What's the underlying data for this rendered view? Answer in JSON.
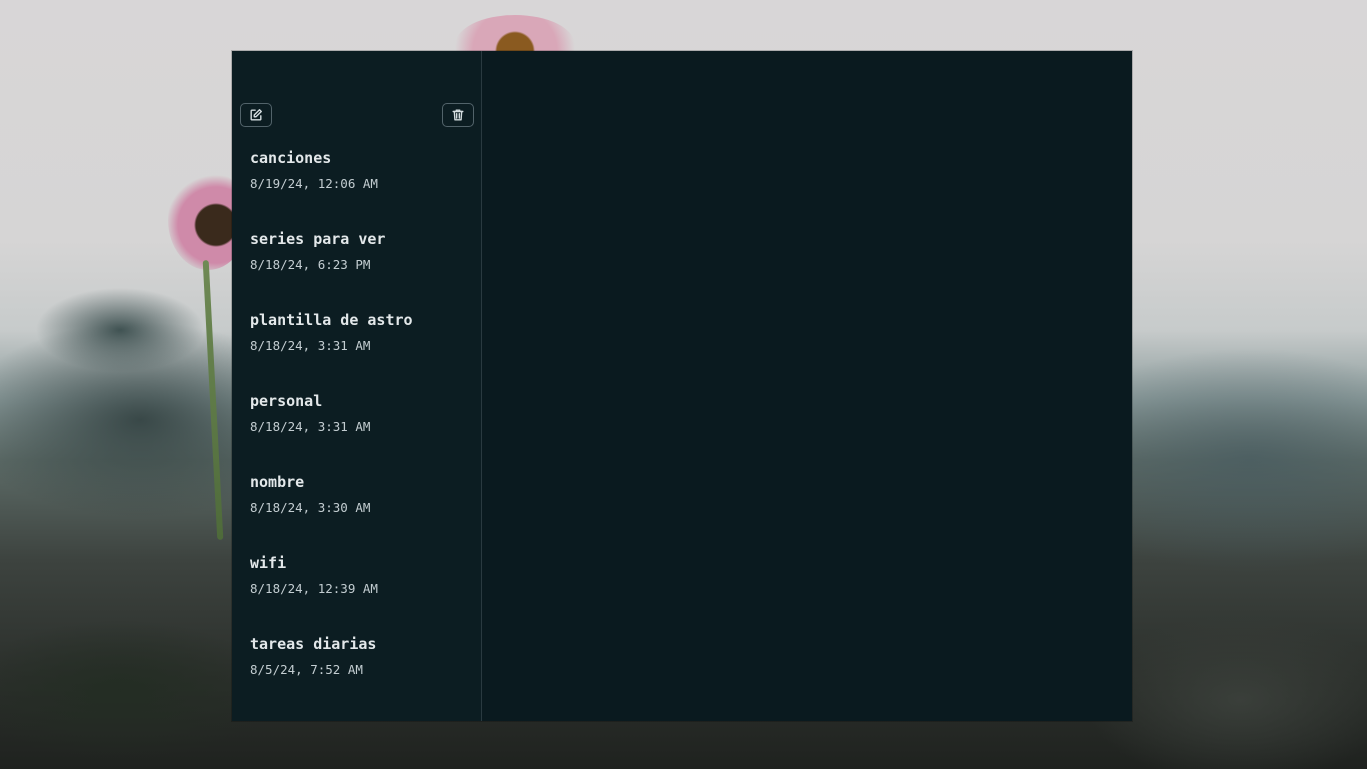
{
  "toolbar": {
    "new_note_icon": "edit-note-icon",
    "delete_icon": "trash-icon"
  },
  "notes": [
    {
      "title": "canciones",
      "date": "8/19/24, 12:06 AM"
    },
    {
      "title": "series para ver",
      "date": "8/18/24, 6:23 PM"
    },
    {
      "title": "plantilla de astro",
      "date": "8/18/24, 3:31 AM"
    },
    {
      "title": "personal",
      "date": "8/18/24, 3:31 AM"
    },
    {
      "title": "nombre",
      "date": "8/18/24, 3:30 AM"
    },
    {
      "title": "wifi",
      "date": "8/18/24, 12:39 AM"
    },
    {
      "title": "tareas diarias",
      "date": "8/5/24, 7:52 AM"
    }
  ],
  "colors": {
    "window_bg": "#0b1b20",
    "text_primary": "#e3e8ea",
    "text_secondary": "#c3cdd1",
    "border": "#52636a"
  }
}
